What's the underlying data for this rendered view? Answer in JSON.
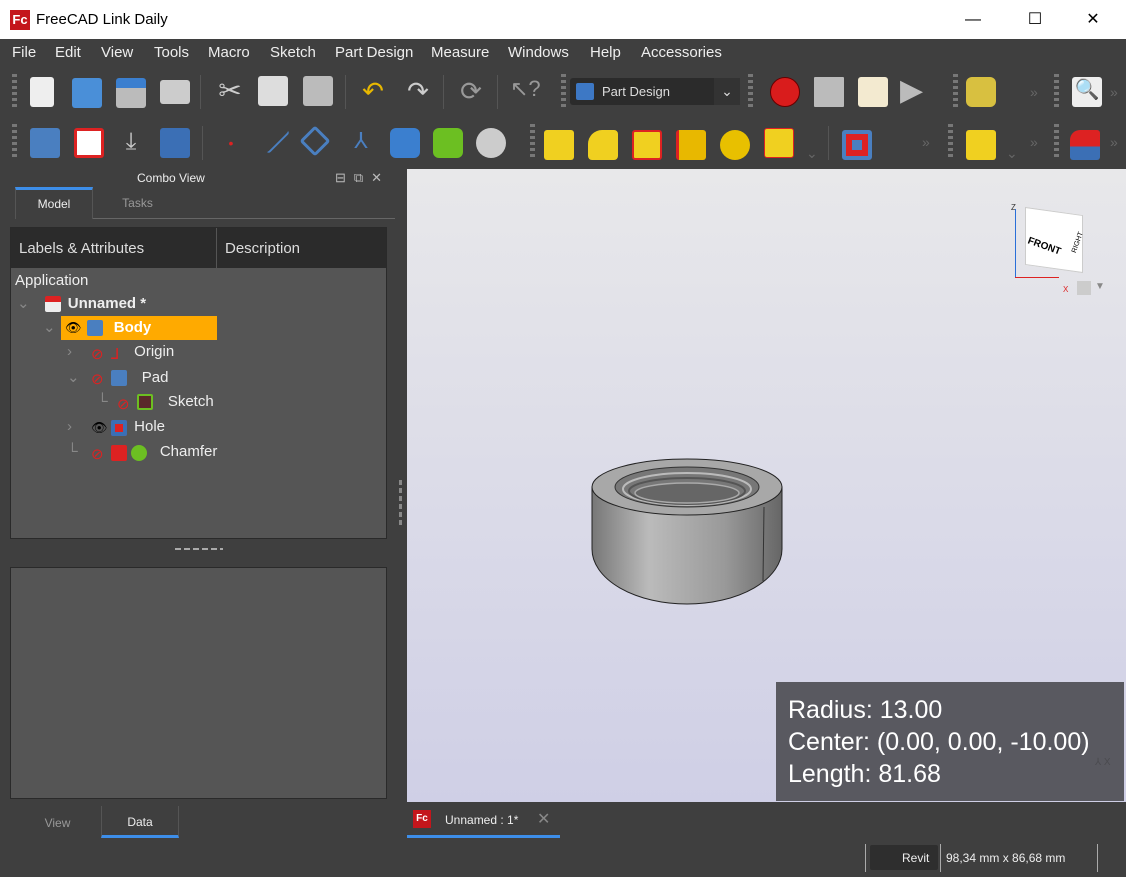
{
  "window": {
    "title": "FreeCAD Link Daily",
    "logo": "Fc",
    "minimize": "—",
    "maximize": "☐",
    "close": "✕"
  },
  "menu": [
    "File",
    "Edit",
    "View",
    "Tools",
    "Macro",
    "Sketch",
    "Part Design",
    "Measure",
    "Windows",
    "Help",
    "Accessories"
  ],
  "workbench": {
    "selected": "Part Design"
  },
  "combo": {
    "title": "Combo View",
    "tabs": [
      "Model",
      "Tasks"
    ],
    "bottom_tabs": [
      "View",
      "Data"
    ]
  },
  "tree": {
    "columns": [
      "Labels & Attributes",
      "Description"
    ],
    "root": "Application",
    "items": [
      {
        "label": "Unnamed *"
      },
      {
        "label": "Body"
      },
      {
        "label": "Origin"
      },
      {
        "label": "Pad"
      },
      {
        "label": "Sketch"
      },
      {
        "label": "Hole"
      },
      {
        "label": "Chamfer"
      }
    ]
  },
  "overlay": {
    "radius": "Radius: 13.00",
    "center": "Center: (0.00, 0.00, -10.00)",
    "length": "Length: 81.68"
  },
  "navcube": {
    "front": "FRONT",
    "right": "RIGHT",
    "z": "Z",
    "x": "X"
  },
  "doc_tab": {
    "label": "Unnamed : 1*"
  },
  "status": {
    "nav_style": "Revit",
    "dimensions": "98,34 mm x 86,68 mm"
  },
  "colors": {
    "accent": "#3d8ee9",
    "selection": "#ffaa00"
  }
}
